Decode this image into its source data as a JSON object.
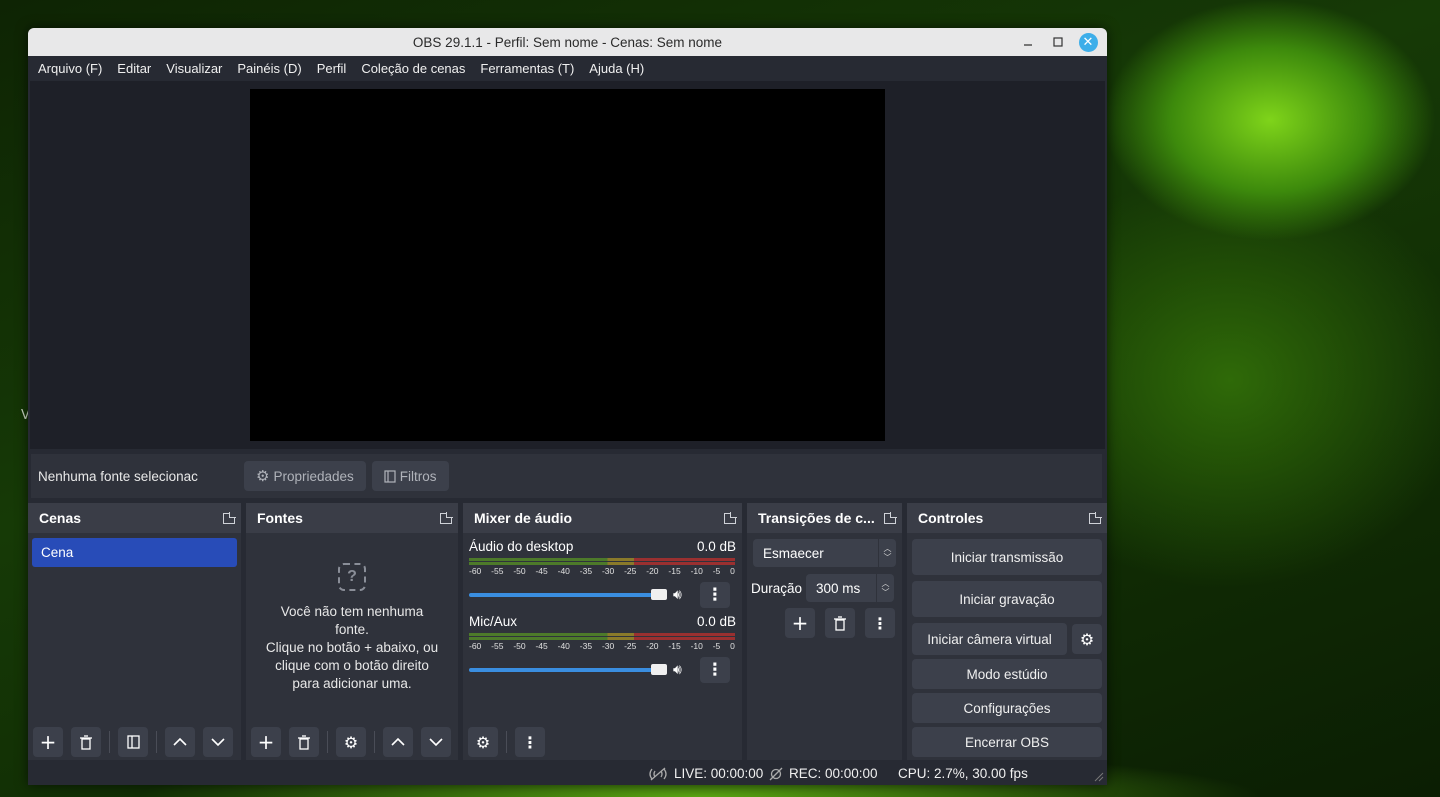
{
  "window": {
    "title": "OBS 29.1.1 - Perfil: Sem nome - Cenas: Sem nome"
  },
  "desktop_letter": "V",
  "menu": [
    "Arquivo (F)",
    "Editar",
    "Visualizar",
    "Painéis (D)",
    "Perfil",
    "Coleção de cenas",
    "Ferramentas (T)",
    "Ajuda (H)"
  ],
  "source_toolbar": {
    "no_source": "Nenhuma fonte selecionac",
    "properties": "Propriedades",
    "filters": "Filtros"
  },
  "scenes": {
    "title": "Cenas",
    "items": [
      "Cena"
    ]
  },
  "sources": {
    "title": "Fontes",
    "empty_line1": "Você não tem nenhuma",
    "empty_line2": "fonte.",
    "empty_line3": "Clique no botão + abaixo, ou",
    "empty_line4": "clique com o botão direito",
    "empty_line5": "para adicionar uma."
  },
  "mixer": {
    "title": "Mixer de áudio",
    "ticks": [
      "-60",
      "-55",
      "-50",
      "-45",
      "-40",
      "-35",
      "-30",
      "-25",
      "-20",
      "-15",
      "-10",
      "-5",
      "0"
    ],
    "channels": [
      {
        "name": "Áudio do desktop",
        "level": "0.0 dB",
        "volume": 1.0
      },
      {
        "name": "Mic/Aux",
        "level": "0.0 dB",
        "volume": 1.0
      }
    ]
  },
  "transitions": {
    "title": "Transições de c...",
    "selected": "Esmaecer",
    "duration_label": "Duração",
    "duration_value": "300 ms"
  },
  "controls": {
    "title": "Controles",
    "start_stream": "Iniciar transmissão",
    "start_recording": "Iniciar gravação",
    "start_virtual_cam": "Iniciar câmera virtual",
    "studio_mode": "Modo estúdio",
    "settings": "Configurações",
    "exit": "Encerrar OBS"
  },
  "status": {
    "live": "LIVE: 00:00:00",
    "rec": "REC: 00:00:00",
    "cpu": "CPU: 2.7%, 30.00 fps"
  },
  "colors": {
    "accent": "#3daee9",
    "selection": "#284cb8",
    "panel": "#2f323b"
  }
}
